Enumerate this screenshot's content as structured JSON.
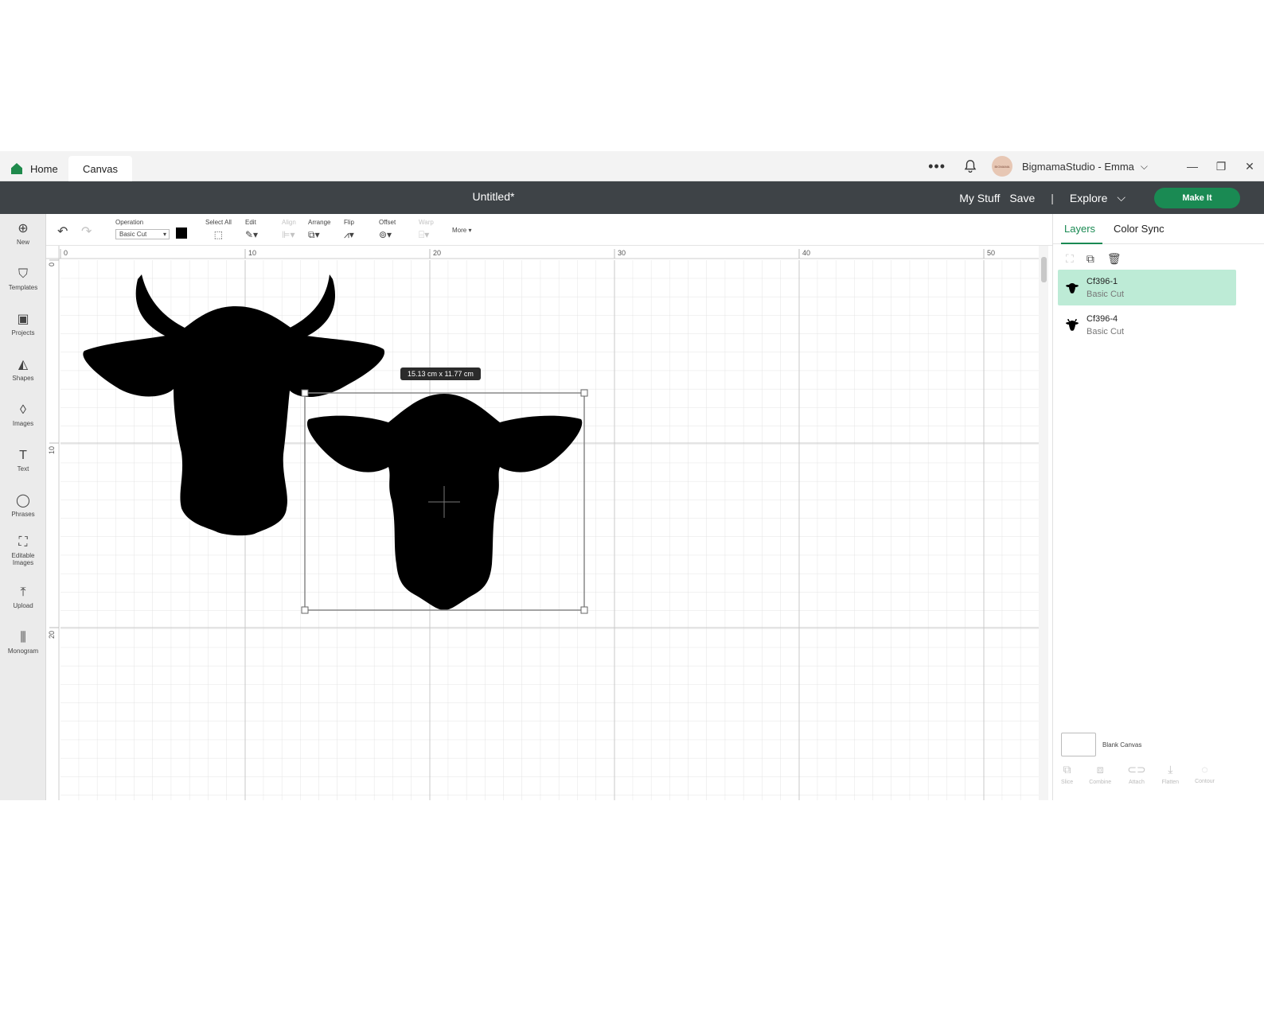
{
  "titlebar": {
    "home_tab": "Home",
    "canvas_tab": "Canvas",
    "more": "•••",
    "avatar_text": "BIGMAMA",
    "user": "BigmamaStudio - Emma",
    "user_chevron": "⌵",
    "minimize": "—",
    "restore": "❐",
    "close": "✕"
  },
  "header": {
    "title": "Untitled*",
    "my_stuff": "My Stuff",
    "save": "Save",
    "separator": "|",
    "explore": "Explore",
    "explore_chevron": "⌵",
    "make_it": "Make It",
    "accent_color": "#1a8a53"
  },
  "leftbar": {
    "items": [
      {
        "label": "New",
        "icon": "plus-circle-icon",
        "glyph": "⊕"
      },
      {
        "label": "Templates",
        "icon": "shirt-icon",
        "glyph": "👕"
      },
      {
        "label": "Projects",
        "icon": "clipboard-icon",
        "glyph": "📋"
      },
      {
        "label": "Shapes",
        "icon": "shapes-icon",
        "glyph": "◭"
      },
      {
        "label": "Images",
        "icon": "lightbulb-icon",
        "glyph": "💡"
      },
      {
        "label": "Text",
        "icon": "text-icon",
        "glyph": "T"
      },
      {
        "label": "Phrases",
        "icon": "speech-bubble-icon",
        "glyph": "💬"
      },
      {
        "label": "Editable Images",
        "icon": "editable-image-icon",
        "glyph": "⛶"
      },
      {
        "label": "Upload",
        "icon": "upload-icon",
        "glyph": "⤒"
      },
      {
        "label": "Monogram",
        "icon": "monogram-icon",
        "glyph": "⫼"
      }
    ]
  },
  "toolbar": {
    "undo": "↶",
    "redo": "↷",
    "operation_label": "Operation",
    "operation_value": "Basic Cut",
    "operation_caret": "▾",
    "select_all": "Select All",
    "edit": "Edit",
    "align": "Align",
    "arrange": "Arrange",
    "flip": "Flip",
    "offset": "Offset",
    "warp": "Warp",
    "more": "More ▾"
  },
  "canvas": {
    "ruler_top": [
      "0",
      "10",
      "20",
      "30",
      "40",
      "50"
    ],
    "ruler_left": [
      "0",
      "10",
      "20"
    ],
    "dimension_tooltip": "15.13  cm x 11.77  cm"
  },
  "rightpanel": {
    "tab_layers": "Layers",
    "tab_color_sync": "Color Sync",
    "layers": [
      {
        "name": "Cf396-1",
        "operation": "Basic Cut",
        "selected": true
      },
      {
        "name": "Cf396-4",
        "operation": "Basic Cut",
        "selected": false
      }
    ],
    "blank_canvas": "Blank Canvas",
    "bottom_actions": [
      {
        "label": "Slice",
        "icon": "slice-icon",
        "glyph": "⧉"
      },
      {
        "label": "Combine",
        "icon": "combine-icon",
        "glyph": "⧈"
      },
      {
        "label": "Attach",
        "icon": "attach-icon",
        "glyph": "⊂⊃"
      },
      {
        "label": "Flatten",
        "icon": "flatten-icon",
        "glyph": "⤓"
      },
      {
        "label": "Contour",
        "icon": "contour-icon",
        "glyph": "◌"
      }
    ]
  }
}
